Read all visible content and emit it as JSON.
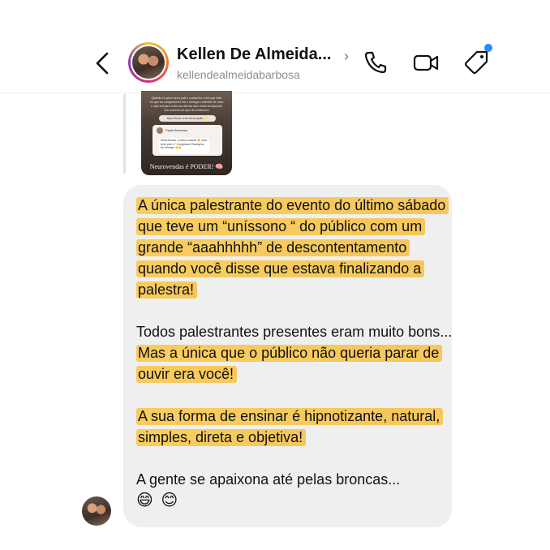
{
  "header": {
    "name": "Kellen De Almeida...",
    "chevron": "›",
    "handle": "kellendealmeidabarbosa",
    "icons": [
      "back-icon",
      "phone-icon",
      "video-call-icon",
      "tag-icon"
    ],
    "notification_dot_color": "#2d88ff"
  },
  "story_reply": {
    "text": "Quando eu pisei nesse palco a primeira coisa que falei foi que ira comprometer em a entregar conteúdo de valor e ajda tod para todos em alavim mas venda inclupendo dos maneios do que eles tenhasses",
    "pill": "Aqui ficou uma descrição ✨",
    "card_name": "Paulo Emerson",
    "card_message": "Mina Biroba, a única notável 🔥 tudo bom pelo 1º Congresso Parahyma de Vendas 👏👏",
    "caption": "Neurovendas é PODER! 🧠"
  },
  "message": {
    "paragraphs": [
      {
        "plain": "",
        "highlight": "A única palestrante do evento do último sábado que teve um “uníssono “ do público com um grande “aaahhhhh” de descontentamento quando você disse que estava finalizando a palestra!"
      },
      {
        "plain": "Todos palestrantes presentes eram muito bons...",
        "highlight": "Mas a única que o público não queria parar de ouvir era você!"
      },
      {
        "plain": "",
        "highlight": "A sua forma de ensinar é hipnotizante, natural, simples, direta e objetiva!"
      },
      {
        "plain": "A gente se apaixona até pelas broncas...",
        "highlight": ""
      }
    ],
    "emojis": "😄 😊",
    "highlight_color": "#f8c646",
    "bubble_color": "#efefef"
  }
}
